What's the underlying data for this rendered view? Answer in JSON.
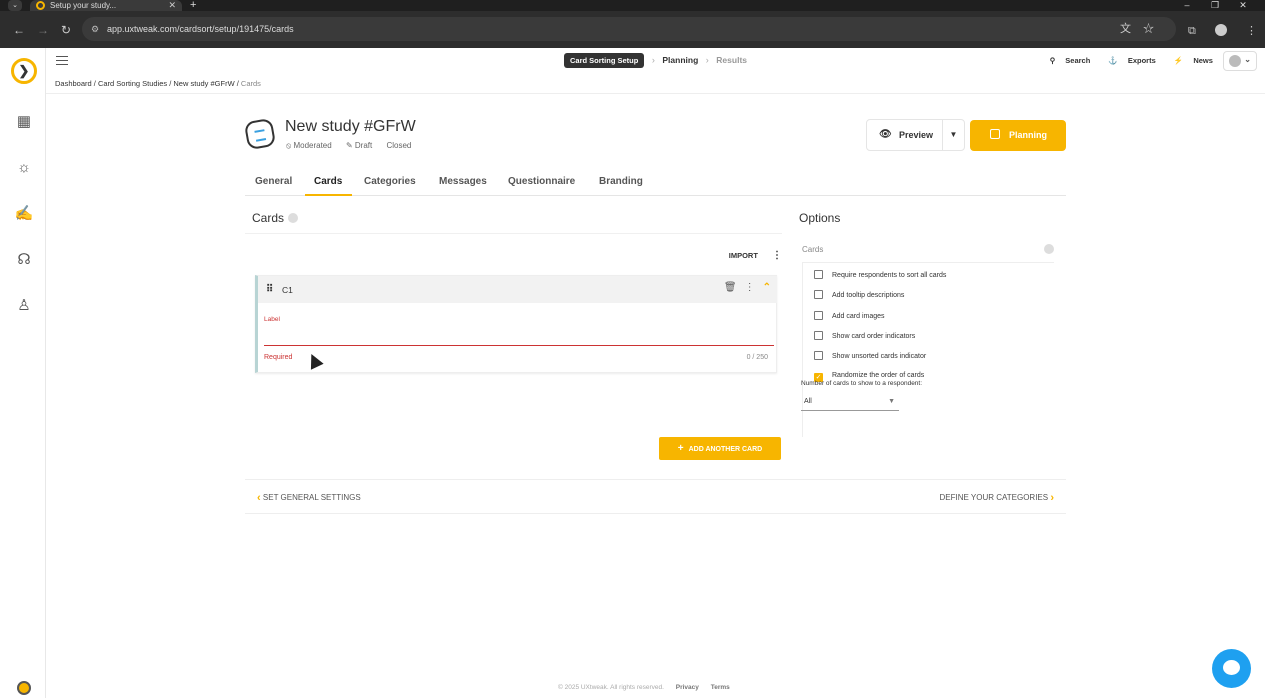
{
  "browser": {
    "tab_title": "Setup your study...",
    "url": "app.uxtweak.com/cardsort/setup/191475/cards"
  },
  "topbar": {
    "steps": [
      "Card Sorting Setup",
      "Planning",
      "Results"
    ],
    "search": "Search",
    "exports": "Exports",
    "news": "News"
  },
  "breadcrumb": {
    "links": "Dashboard / Card Sorting Studies / New study #GFrW /",
    "current": "Cards"
  },
  "study": {
    "title": "New study #GFrW",
    "mode": "Moderated",
    "state": "Draft",
    "status": "Closed",
    "preview_label": "Preview",
    "planning_label": "Planning"
  },
  "tabs": [
    "General",
    "Cards",
    "Categories",
    "Messages",
    "Questionnaire",
    "Branding"
  ],
  "cards_panel": {
    "title": "Cards",
    "import_label": "IMPORT",
    "card": {
      "name": "C1",
      "field_label": "Label",
      "error": "Required",
      "counter": "0 / 250"
    },
    "add_button": "ADD ANOTHER CARD"
  },
  "options_panel": {
    "title": "Options",
    "section": "Cards",
    "checkboxes": [
      {
        "label": "Require respondents to sort all cards",
        "checked": false
      },
      {
        "label": "Add tooltip descriptions",
        "checked": false
      },
      {
        "label": "Add card images",
        "checked": false
      },
      {
        "label": "Show card order indicators",
        "checked": false
      },
      {
        "label": "Show unsorted cards indicator",
        "checked": false
      },
      {
        "label": "Randomize the order of cards",
        "checked": true
      }
    ],
    "number_label": "Number of cards to show to a respondent:",
    "number_value": "All"
  },
  "step_nav": {
    "prev": "SET GENERAL SETTINGS",
    "next": "DEFINE YOUR CATEGORIES"
  },
  "footer": {
    "copyright": "© 2025 UXtweak. All rights reserved.",
    "privacy": "Privacy",
    "terms": "Terms"
  },
  "colors": {
    "accent": "#f7b500",
    "error": "#cc3333",
    "chat": "#1ea0f0"
  }
}
